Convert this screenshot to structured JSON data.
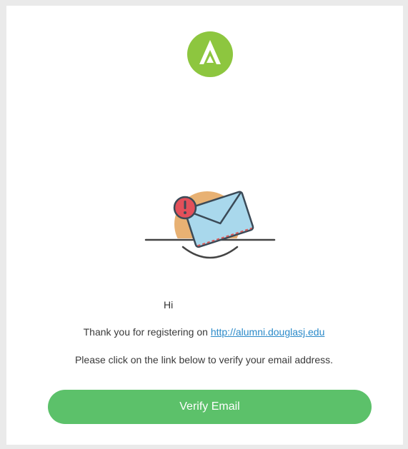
{
  "email": {
    "greeting": "Hi",
    "registration_text": "Thank you for registering on",
    "registration_link": "http://alumni.douglasj.edu",
    "instruction_text": "Please click on the link below to verify your email address.",
    "verify_button_label": "Verify Email"
  },
  "icons": {
    "logo": "a-letter-logo-icon",
    "illustration": "envelope-alert-icon"
  },
  "colors": {
    "logo_green": "#8dc63f",
    "button_green": "#5cc16a",
    "link_blue": "#2b8ac9",
    "envelope_blue": "#a9d8ec",
    "alert_red": "#e3505a",
    "sun_orange": "#e8a96a",
    "frame_gray": "#eaeaea"
  }
}
